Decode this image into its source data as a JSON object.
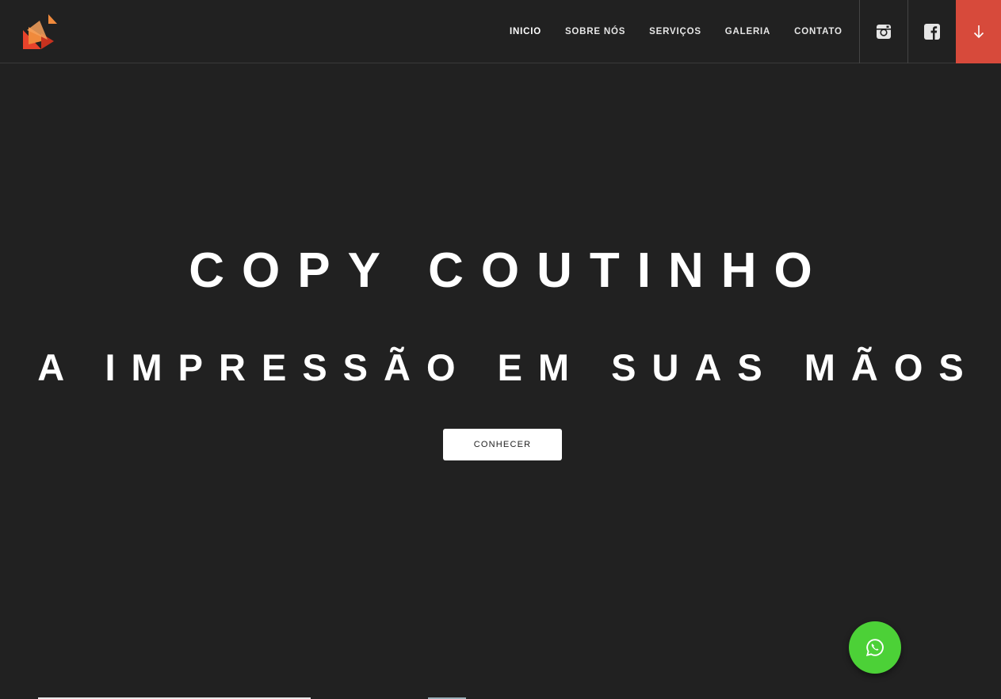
{
  "brand": {
    "logo_icon": "triangles-logo-icon",
    "colors": {
      "orange": "#f08a3c",
      "red": "#e8432b",
      "dark_red": "#c7321f"
    }
  },
  "nav": {
    "items": [
      {
        "label": "INICIO",
        "active": true
      },
      {
        "label": "SOBRE NÓS",
        "active": false
      },
      {
        "label": "SERVIÇOS",
        "active": false
      },
      {
        "label": "GALERIA",
        "active": false
      },
      {
        "label": "CONTATO",
        "active": false
      }
    ]
  },
  "social": {
    "instagram_icon": "instagram-icon",
    "facebook_icon": "facebook-icon"
  },
  "scroll_button": {
    "icon": "arrow-down-icon",
    "color": "#d74a3b"
  },
  "hero": {
    "title": "COPY COUTINHO",
    "subtitle": "A IMPRESSÃO EM SUAS MÃOS",
    "cta_label": "CONHECER"
  },
  "whatsapp": {
    "icon": "whatsapp-icon",
    "color": "#4cd137"
  }
}
